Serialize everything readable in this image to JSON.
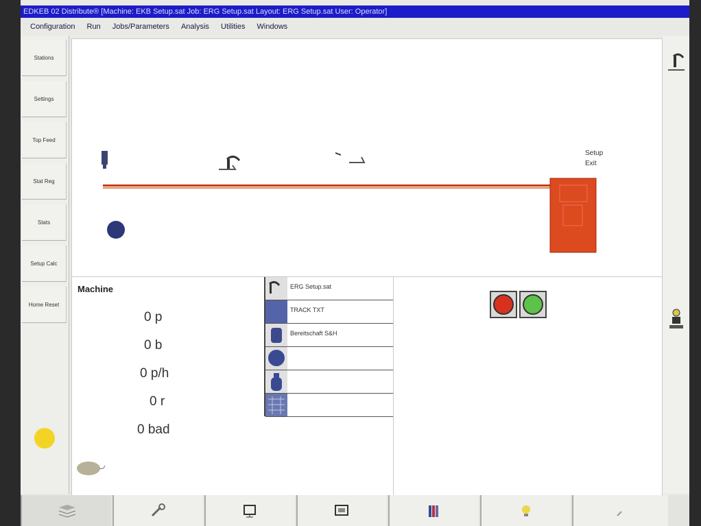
{
  "window": {
    "title": "EDKEB 02 Distribute® [Machine: EKB Setup.sat   Job: ERG Setup.sat   Layout: ERG Setup.sat   User: Operator]"
  },
  "menu": [
    "Configuration",
    "Run",
    "Jobs/Parameters",
    "Analysis",
    "Utilities",
    "Windows"
  ],
  "sidebar": {
    "buttons": [
      "Stations",
      "Settings",
      "Top Feed",
      "Stat Reg",
      "Stats",
      "Setup Calc",
      "Home Reset"
    ],
    "indicator_color": "#f3d425"
  },
  "machine": {
    "title": "Machine",
    "stats": [
      "0  p",
      "0  b",
      "0 p/h",
      "0 r",
      "0 bad"
    ]
  },
  "stations": [
    {
      "icon": "station-icon",
      "label": "ERG Setup.sat"
    },
    {
      "icon": "feeder-icon",
      "label": "TRACK TXT"
    },
    {
      "icon": "stacker-icon",
      "label": "Bereitschaft S&H"
    },
    {
      "icon": "sphere-icon",
      "label": ""
    },
    {
      "icon": "bottle-icon",
      "label": ""
    },
    {
      "icon": "grid-icon",
      "label": ""
    }
  ],
  "controls": {
    "stop_color": "#d8321f",
    "start_color": "#5dc24a"
  },
  "layout_view": {
    "conveyor_color": "#cc3a1a",
    "output_color": "#dc4a1f",
    "output_label": "Setup\nExit"
  },
  "bottom_toolbar": [
    "stack-icon",
    "tools-icon",
    "monitor-icon",
    "display-icon",
    "books-icon",
    "lightbulb-icon",
    "page-icon"
  ]
}
